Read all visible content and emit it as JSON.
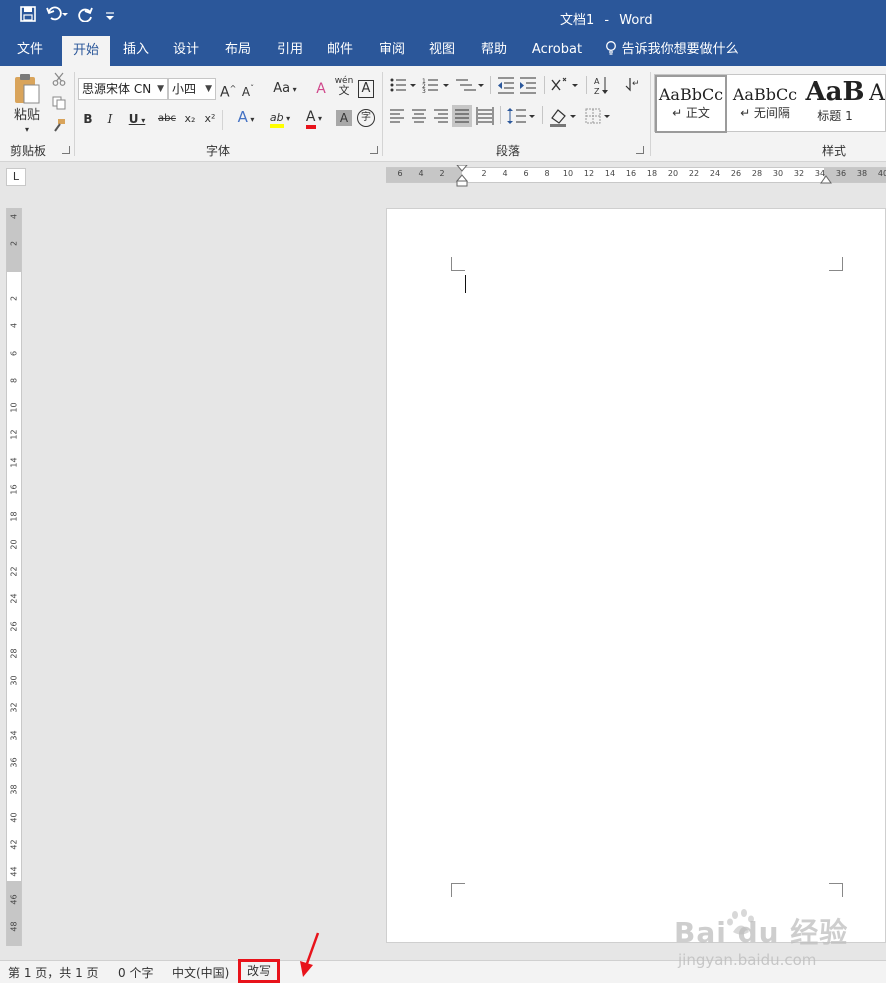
{
  "title_bar": {
    "document": "文档1",
    "separator": "-",
    "app": "Word"
  },
  "qat": {
    "icons": [
      "save-icon",
      "undo-icon",
      "redo-icon",
      "customize-icon"
    ]
  },
  "tabs": [
    "文件",
    "开始",
    "插入",
    "设计",
    "布局",
    "引用",
    "邮件",
    "审阅",
    "视图",
    "帮助",
    "Acrobat"
  ],
  "active_tab": "开始",
  "tell_me": "告诉我你想要做什么",
  "ribbon": {
    "clipboard": {
      "paste": "粘贴",
      "label": "剪贴板"
    },
    "font": {
      "font_name": "思源宋体 CN",
      "font_size": "小四",
      "grow": "A",
      "shrink": "A",
      "case": "Aa",
      "clear": "A",
      "phonetic_top": "wén",
      "phonetic_bottom": "文",
      "border_char": "A",
      "bold": "B",
      "italic": "I",
      "underline": "U",
      "strike": "abc",
      "sub": "x₂",
      "sup": "x²",
      "effects": "A",
      "highlight": "ab",
      "font_color": "A",
      "shading": "A",
      "enclose": "字",
      "label": "字体"
    },
    "paragraph": {
      "label": "段落"
    },
    "styles": {
      "label": "样式",
      "items": [
        {
          "sample": "AaBbCc",
          "name": "↵ 正文"
        },
        {
          "sample": "AaBbCc",
          "name": "↵ 无间隔"
        },
        {
          "sample": "AaB",
          "name": "标题 1"
        },
        {
          "sample": "A",
          "name": ""
        }
      ]
    }
  },
  "ruler": {
    "horizontal": [
      "6",
      "4",
      "2",
      "",
      "2",
      "4",
      "6",
      "8",
      "10",
      "12",
      "14",
      "16",
      "18",
      "20",
      "22",
      "24",
      "26",
      "28",
      "30",
      "32",
      "34",
      "36",
      "38",
      "40"
    ],
    "vertical": [
      "4",
      "2",
      "",
      "2",
      "4",
      "6",
      "8",
      "10",
      "12",
      "14",
      "16",
      "18",
      "20",
      "22",
      "24",
      "26",
      "28",
      "30",
      "32",
      "34",
      "36",
      "38",
      "40",
      "42",
      "44",
      "46",
      "48"
    ],
    "tab_selector": "L"
  },
  "status": {
    "page": "第 1 页，共 1 页",
    "words": "0 个字",
    "language": "中文(中国)",
    "mode": "改写"
  },
  "watermark": {
    "brand": "Bai du 经验",
    "url": "jingyan.baidu.com"
  },
  "colors": {
    "brand": "#2b579a",
    "highlight": "#e8131b"
  }
}
